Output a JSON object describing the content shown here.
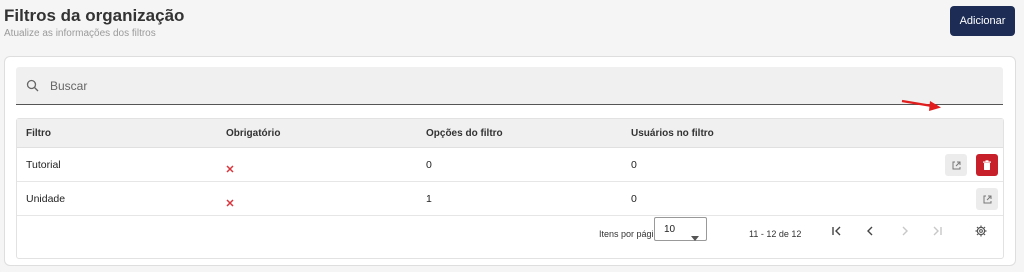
{
  "header": {
    "title": "Filtros da organização",
    "subtitle": "Atualize as informações dos filtros",
    "add_label": "Adicionar"
  },
  "search": {
    "placeholder": "Buscar"
  },
  "table": {
    "columns": [
      "Filtro",
      "Obrigatório",
      "Opções do filtro",
      "Usuários no filtro"
    ],
    "rows": [
      {
        "filtro": "Tutorial",
        "obrigatorio": false,
        "opcoes": "0",
        "usuarios": "0"
      },
      {
        "filtro": "Unidade",
        "obrigatorio": false,
        "opcoes": "1",
        "usuarios": "0"
      }
    ]
  },
  "pagination": {
    "items_per_page_label": "Itens por página",
    "items_per_page_value": "10",
    "range_text": "11 - 12 de 12"
  },
  "colors": {
    "primary": "#1c2c55",
    "danger": "#c8202a",
    "x_mark": "#d9363e",
    "annotation_arrow": "#e11d1d"
  },
  "icons": [
    "search-icon",
    "close-icon",
    "open-external-icon",
    "trash-icon",
    "first-page-icon",
    "prev-page-icon",
    "next-page-icon",
    "last-page-icon",
    "gear-icon",
    "chevron-down-icon",
    "arrow-annotation-icon"
  ]
}
